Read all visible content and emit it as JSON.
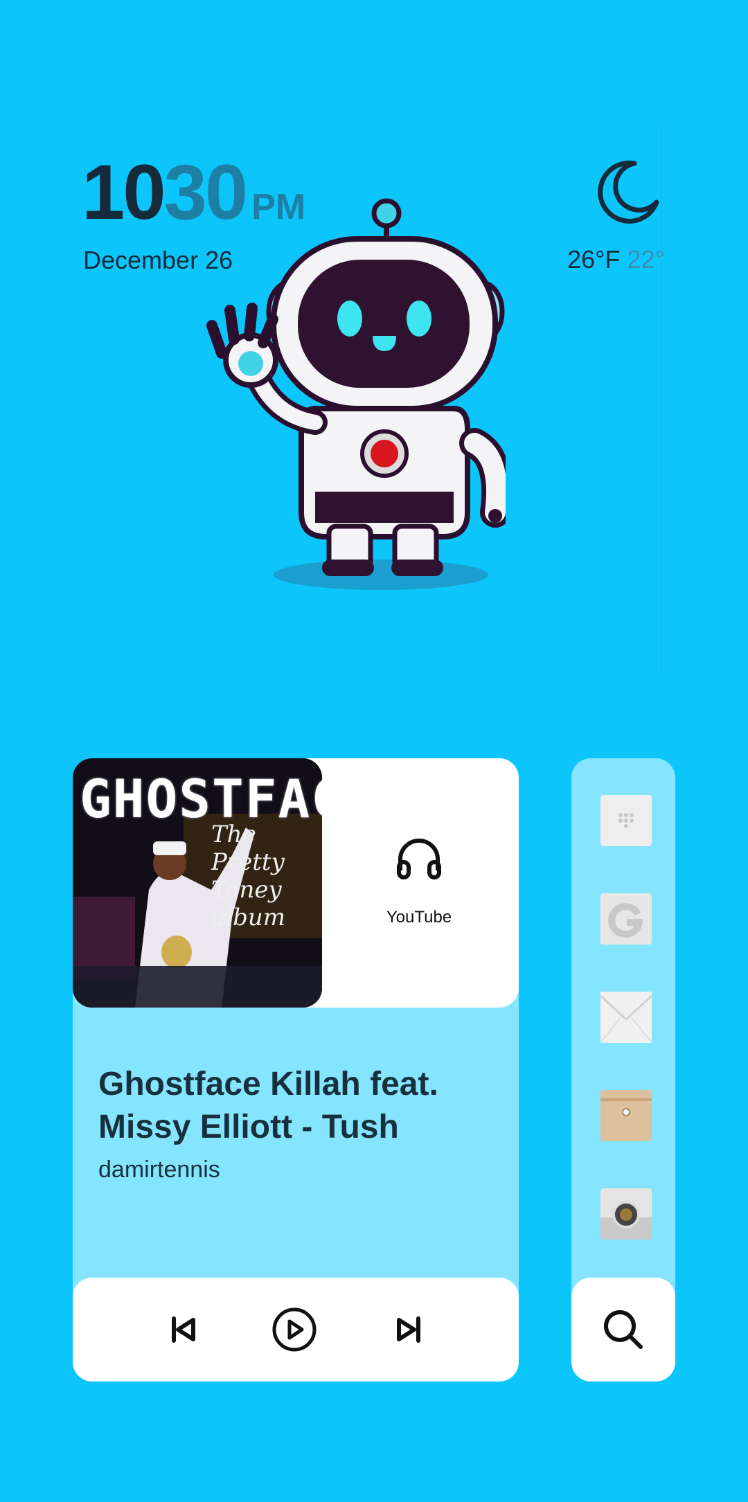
{
  "clock": {
    "hour": "10",
    "minute": "30",
    "ampm": "PM",
    "date": "December 26"
  },
  "weather": {
    "icon": "moon-icon",
    "temp_high": "26°F",
    "temp_low": "22°"
  },
  "music": {
    "album_title": "GHOSTFACE",
    "album_subtitle": "The Pretty Toney album",
    "source_icon": "headphones-icon",
    "source_label": "YouTube",
    "song_title": "Ghostface Killah feat. Missy Elliott - Tush",
    "artist": "damirtennis",
    "controls": [
      "previous-icon",
      "play-icon",
      "next-icon"
    ]
  },
  "dock": {
    "apps": [
      "phone-app-icon",
      "google-app-icon",
      "mail-app-icon",
      "files-app-icon",
      "camera-app-icon"
    ],
    "search_icon": "search-icon"
  },
  "colors": {
    "background": "#0cc6fb",
    "card": "#86e5fe",
    "accent": "#1d7fa3"
  }
}
